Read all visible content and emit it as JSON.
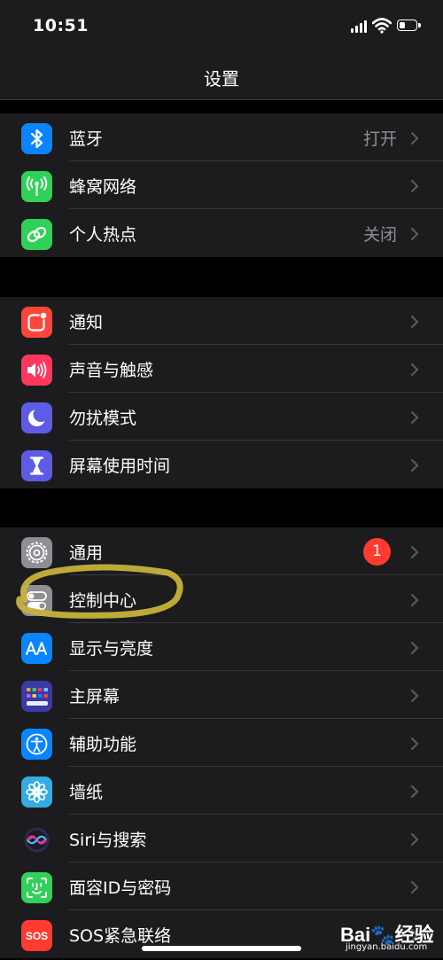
{
  "status_bar": {
    "time": "10:51",
    "battery_level": 0.35
  },
  "nav": {
    "title": "设置"
  },
  "group1": [
    {
      "label": "蓝牙",
      "value": "打开",
      "icon": "bluetooth-icon",
      "color": "#0a84ff"
    },
    {
      "label": "蜂窝网络",
      "value": "",
      "icon": "cellular-antenna-icon",
      "color": "#30d158"
    },
    {
      "label": "个人热点",
      "value": "关闭",
      "icon": "hotspot-chain-icon",
      "color": "#30d158"
    }
  ],
  "group2": [
    {
      "label": "通知",
      "icon": "notifications-icon",
      "color": "#ff453a"
    },
    {
      "label": "声音与触感",
      "icon": "speaker-icon",
      "color": "#ff375f"
    },
    {
      "label": "勿扰模式",
      "icon": "moon-icon",
      "color": "#5e5ce6"
    },
    {
      "label": "屏幕使用时间",
      "icon": "hourglass-icon",
      "color": "#5e5ce6"
    }
  ],
  "group3": [
    {
      "label": "通用",
      "badge": "1",
      "icon": "gear-icon",
      "color": "#8e8e93"
    },
    {
      "label": "控制中心",
      "icon": "toggles-icon",
      "color": "#8e8e93"
    },
    {
      "label": "显示与亮度",
      "icon": "text-size-icon",
      "color": "#0a84ff"
    },
    {
      "label": "主屏幕",
      "icon": "app-grid-icon",
      "color": "#3a3aa8"
    },
    {
      "label": "辅助功能",
      "icon": "accessibility-icon",
      "color": "#0a84ff"
    },
    {
      "label": "墙纸",
      "icon": "flower-icon",
      "color": "#32ade6"
    },
    {
      "label": "Siri与搜索",
      "icon": "siri-icon",
      "color": "#1c1c1e"
    },
    {
      "label": "面容ID与密码",
      "icon": "face-id-icon",
      "color": "#30d158"
    },
    {
      "label": "SOS紧急联络",
      "icon": "sos-icon",
      "color": "#ff3b30"
    }
  ],
  "watermark": {
    "logo": "Bai🐾经验",
    "url": "jingyan.baidu.com"
  }
}
